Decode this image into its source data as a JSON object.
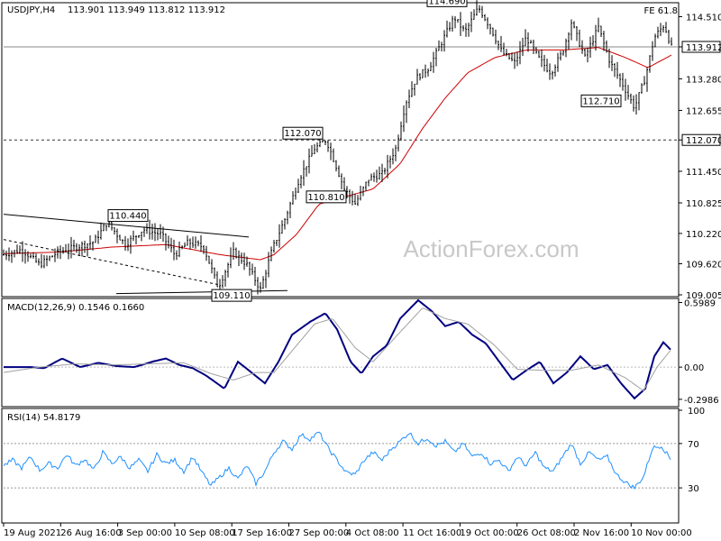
{
  "header": {
    "symbol": "USDJPY,H4",
    "ohlc": "113.901 113.949 113.812 113.912",
    "fe_label": "FE 61.8"
  },
  "watermark": "ActionForex.com",
  "colors": {
    "price": "#000000",
    "ma": "#cc0000",
    "macd": "#000080",
    "macd_signal": "#a0a0a0",
    "rsi": "#1e90ff",
    "background": "#ffffff"
  },
  "chart_data": [
    {
      "type": "candlestick",
      "title": "USDJPY,H4",
      "ylim": [
        109.005,
        114.75
      ],
      "y_ticks": [
        "114.510",
        "113.912",
        "113.280",
        "112.655",
        "112.070",
        "111.450",
        "110.825",
        "110.220",
        "109.620",
        "109.005"
      ],
      "x_ticks": [
        "19 Aug 2021",
        "26 Aug 16:00",
        "3 Sep 00:00",
        "10 Sep 08:00",
        "17 Sep 16:00",
        "27 Sep 00:00",
        "4 Oct 08:00",
        "11 Oct 16:00",
        "19 Oct 00:00",
        "26 Oct 08:00",
        "2 Nov 16:00",
        "10 Nov 00:00"
      ],
      "current_price": 113.912,
      "horizontal_levels": [
        {
          "value": 113.912,
          "style": "solid"
        },
        {
          "value": 112.07,
          "style": "dashed"
        }
      ],
      "labels": [
        {
          "text": "114.690",
          "value": 114.69
        },
        {
          "text": "112.070",
          "value": 112.07
        },
        {
          "text": "110.810",
          "value": 110.81
        },
        {
          "text": "110.440",
          "value": 110.44
        },
        {
          "text": "109.110",
          "value": 109.11
        },
        {
          "text": "112.710",
          "value": 112.71
        }
      ],
      "price_path": [
        {
          "x": 0,
          "v": 109.8
        },
        {
          "x": 20,
          "v": 109.9
        },
        {
          "x": 40,
          "v": 109.6
        },
        {
          "x": 60,
          "v": 109.85
        },
        {
          "x": 80,
          "v": 109.95
        },
        {
          "x": 100,
          "v": 110.05
        },
        {
          "x": 115,
          "v": 110.44
        },
        {
          "x": 135,
          "v": 110.0
        },
        {
          "x": 155,
          "v": 110.3
        },
        {
          "x": 175,
          "v": 110.2
        },
        {
          "x": 190,
          "v": 109.8
        },
        {
          "x": 205,
          "v": 110.05
        },
        {
          "x": 222,
          "v": 109.95
        },
        {
          "x": 238,
          "v": 109.15
        },
        {
          "x": 255,
          "v": 109.85
        },
        {
          "x": 270,
          "v": 109.6
        },
        {
          "x": 285,
          "v": 109.11
        },
        {
          "x": 298,
          "v": 109.9
        },
        {
          "x": 312,
          "v": 110.5
        },
        {
          "x": 328,
          "v": 111.3
        },
        {
          "x": 345,
          "v": 111.9
        },
        {
          "x": 358,
          "v": 112.07
        },
        {
          "x": 368,
          "v": 111.6
        },
        {
          "x": 378,
          "v": 111.1
        },
        {
          "x": 390,
          "v": 110.81
        },
        {
          "x": 405,
          "v": 111.3
        },
        {
          "x": 420,
          "v": 111.4
        },
        {
          "x": 435,
          "v": 111.9
        },
        {
          "x": 446,
          "v": 112.8
        },
        {
          "x": 458,
          "v": 113.3
        },
        {
          "x": 472,
          "v": 113.5
        },
        {
          "x": 486,
          "v": 114.0
        },
        {
          "x": 500,
          "v": 114.5
        },
        {
          "x": 512,
          "v": 114.2
        },
        {
          "x": 527,
          "v": 114.69
        },
        {
          "x": 540,
          "v": 114.3
        },
        {
          "x": 553,
          "v": 113.8
        },
        {
          "x": 567,
          "v": 113.6
        },
        {
          "x": 580,
          "v": 114.1
        },
        {
          "x": 593,
          "v": 113.7
        },
        {
          "x": 607,
          "v": 113.4
        },
        {
          "x": 620,
          "v": 113.8
        },
        {
          "x": 630,
          "v": 114.4
        },
        {
          "x": 645,
          "v": 113.7
        },
        {
          "x": 660,
          "v": 114.3
        },
        {
          "x": 673,
          "v": 113.6
        },
        {
          "x": 686,
          "v": 113.2
        },
        {
          "x": 700,
          "v": 112.71
        },
        {
          "x": 712,
          "v": 113.3
        },
        {
          "x": 722,
          "v": 114.1
        },
        {
          "x": 733,
          "v": 114.35
        },
        {
          "x": 741,
          "v": 113.912
        }
      ],
      "ma_path": [
        {
          "x": 0,
          "v": 109.82
        },
        {
          "x": 60,
          "v": 109.85
        },
        {
          "x": 120,
          "v": 109.95
        },
        {
          "x": 180,
          "v": 110.0
        },
        {
          "x": 240,
          "v": 109.8
        },
        {
          "x": 285,
          "v": 109.7
        },
        {
          "x": 300,
          "v": 109.8
        },
        {
          "x": 325,
          "v": 110.2
        },
        {
          "x": 350,
          "v": 110.8
        },
        {
          "x": 380,
          "v": 110.95
        },
        {
          "x": 410,
          "v": 111.1
        },
        {
          "x": 440,
          "v": 111.6
        },
        {
          "x": 465,
          "v": 112.3
        },
        {
          "x": 490,
          "v": 112.9
        },
        {
          "x": 515,
          "v": 113.4
        },
        {
          "x": 545,
          "v": 113.7
        },
        {
          "x": 580,
          "v": 113.85
        },
        {
          "x": 620,
          "v": 113.85
        },
        {
          "x": 660,
          "v": 113.9
        },
        {
          "x": 690,
          "v": 113.7
        },
        {
          "x": 715,
          "v": 113.5
        },
        {
          "x": 741,
          "v": 113.75
        }
      ],
      "trendlines": [
        {
          "from": {
            "x": 0,
            "v": 110.6
          },
          "to": {
            "x": 272,
            "v": 110.15
          }
        },
        {
          "from": {
            "x": 125,
            "v": 109.03
          },
          "to": {
            "x": 315,
            "v": 109.09
          }
        },
        {
          "from": {
            "x": 0,
            "v": 110.1
          },
          "to": {
            "x": 240,
            "v": 109.2
          },
          "style": "dashed"
        }
      ]
    },
    {
      "type": "line",
      "title": "MACD(12,26,9) 0.1546 0.1660",
      "ylim": [
        -0.35,
        0.62
      ],
      "y_ticks": [
        "0.5989",
        "0.00",
        "-0.2986"
      ],
      "series": [
        {
          "name": "MACD",
          "points": [
            {
              "x": 0,
              "v": 0.0
            },
            {
              "x": 30,
              "v": 0.0
            },
            {
              "x": 45,
              "v": -0.01
            },
            {
              "x": 65,
              "v": 0.08
            },
            {
              "x": 85,
              "v": 0.0
            },
            {
              "x": 105,
              "v": 0.04
            },
            {
              "x": 125,
              "v": 0.01
            },
            {
              "x": 145,
              "v": 0.0
            },
            {
              "x": 165,
              "v": 0.05
            },
            {
              "x": 180,
              "v": 0.08
            },
            {
              "x": 195,
              "v": 0.02
            },
            {
              "x": 210,
              "v": -0.01
            },
            {
              "x": 225,
              "v": -0.08
            },
            {
              "x": 245,
              "v": -0.2
            },
            {
              "x": 260,
              "v": 0.05
            },
            {
              "x": 275,
              "v": -0.05
            },
            {
              "x": 290,
              "v": -0.15
            },
            {
              "x": 305,
              "v": 0.05
            },
            {
              "x": 320,
              "v": 0.3
            },
            {
              "x": 340,
              "v": 0.42
            },
            {
              "x": 357,
              "v": 0.5
            },
            {
              "x": 370,
              "v": 0.35
            },
            {
              "x": 385,
              "v": 0.05
            },
            {
              "x": 397,
              "v": -0.06
            },
            {
              "x": 410,
              "v": 0.1
            },
            {
              "x": 425,
              "v": 0.2
            },
            {
              "x": 440,
              "v": 0.45
            },
            {
              "x": 460,
              "v": 0.62
            },
            {
              "x": 475,
              "v": 0.52
            },
            {
              "x": 490,
              "v": 0.38
            },
            {
              "x": 505,
              "v": 0.42
            },
            {
              "x": 520,
              "v": 0.3
            },
            {
              "x": 535,
              "v": 0.22
            },
            {
              "x": 550,
              "v": 0.05
            },
            {
              "x": 565,
              "v": -0.12
            },
            {
              "x": 580,
              "v": -0.03
            },
            {
              "x": 595,
              "v": 0.05
            },
            {
              "x": 610,
              "v": -0.15
            },
            {
              "x": 625,
              "v": -0.05
            },
            {
              "x": 640,
              "v": 0.1
            },
            {
              "x": 655,
              "v": -0.02
            },
            {
              "x": 670,
              "v": 0.02
            },
            {
              "x": 685,
              "v": -0.15
            },
            {
              "x": 700,
              "v": -0.29
            },
            {
              "x": 712,
              "v": -0.2
            },
            {
              "x": 722,
              "v": 0.1
            },
            {
              "x": 732,
              "v": 0.23
            },
            {
              "x": 741,
              "v": 0.1546
            }
          ]
        },
        {
          "name": "Signal",
          "points": [
            {
              "x": 0,
              "v": -0.05
            },
            {
              "x": 40,
              "v": 0.0
            },
            {
              "x": 80,
              "v": 0.03
            },
            {
              "x": 120,
              "v": 0.02
            },
            {
              "x": 160,
              "v": 0.03
            },
            {
              "x": 200,
              "v": 0.04
            },
            {
              "x": 230,
              "v": -0.06
            },
            {
              "x": 255,
              "v": -0.12
            },
            {
              "x": 280,
              "v": -0.05
            },
            {
              "x": 300,
              "v": -0.05
            },
            {
              "x": 320,
              "v": 0.15
            },
            {
              "x": 345,
              "v": 0.4
            },
            {
              "x": 365,
              "v": 0.45
            },
            {
              "x": 390,
              "v": 0.18
            },
            {
              "x": 410,
              "v": 0.05
            },
            {
              "x": 435,
              "v": 0.28
            },
            {
              "x": 465,
              "v": 0.55
            },
            {
              "x": 490,
              "v": 0.45
            },
            {
              "x": 515,
              "v": 0.4
            },
            {
              "x": 545,
              "v": 0.2
            },
            {
              "x": 570,
              "v": -0.02
            },
            {
              "x": 600,
              "v": -0.03
            },
            {
              "x": 630,
              "v": -0.03
            },
            {
              "x": 660,
              "v": 0.02
            },
            {
              "x": 690,
              "v": -0.1
            },
            {
              "x": 710,
              "v": -0.22
            },
            {
              "x": 725,
              "v": 0.0
            },
            {
              "x": 741,
              "v": 0.166
            }
          ]
        }
      ]
    },
    {
      "type": "line",
      "title": "RSI(14) 54.8179",
      "ylim": [
        0,
        100
      ],
      "y_ticks": [
        "100",
        "70",
        "30"
      ],
      "series": [
        {
          "name": "RSI",
          "points": [
            {
              "x": 0,
              "v": 50
            },
            {
              "x": 10,
              "v": 55
            },
            {
              "x": 20,
              "v": 48
            },
            {
              "x": 30,
              "v": 58
            },
            {
              "x": 40,
              "v": 46
            },
            {
              "x": 50,
              "v": 52
            },
            {
              "x": 60,
              "v": 48
            },
            {
              "x": 70,
              "v": 60
            },
            {
              "x": 80,
              "v": 50
            },
            {
              "x": 90,
              "v": 56
            },
            {
              "x": 100,
              "v": 46
            },
            {
              "x": 110,
              "v": 62
            },
            {
              "x": 120,
              "v": 52
            },
            {
              "x": 130,
              "v": 58
            },
            {
              "x": 140,
              "v": 48
            },
            {
              "x": 150,
              "v": 55
            },
            {
              "x": 160,
              "v": 45
            },
            {
              "x": 170,
              "v": 60
            },
            {
              "x": 180,
              "v": 52
            },
            {
              "x": 190,
              "v": 55
            },
            {
              "x": 200,
              "v": 45
            },
            {
              "x": 210,
              "v": 58
            },
            {
              "x": 220,
              "v": 44
            },
            {
              "x": 230,
              "v": 32
            },
            {
              "x": 240,
              "v": 40
            },
            {
              "x": 250,
              "v": 48
            },
            {
              "x": 260,
              "v": 38
            },
            {
              "x": 270,
              "v": 50
            },
            {
              "x": 280,
              "v": 34
            },
            {
              "x": 290,
              "v": 45
            },
            {
              "x": 300,
              "v": 62
            },
            {
              "x": 310,
              "v": 72
            },
            {
              "x": 320,
              "v": 65
            },
            {
              "x": 330,
              "v": 78
            },
            {
              "x": 340,
              "v": 74
            },
            {
              "x": 350,
              "v": 80
            },
            {
              "x": 360,
              "v": 66
            },
            {
              "x": 370,
              "v": 55
            },
            {
              "x": 380,
              "v": 44
            },
            {
              "x": 390,
              "v": 42
            },
            {
              "x": 400,
              "v": 55
            },
            {
              "x": 410,
              "v": 62
            },
            {
              "x": 420,
              "v": 55
            },
            {
              "x": 430,
              "v": 65
            },
            {
              "x": 440,
              "v": 72
            },
            {
              "x": 450,
              "v": 80
            },
            {
              "x": 460,
              "v": 70
            },
            {
              "x": 470,
              "v": 75
            },
            {
              "x": 480,
              "v": 68
            },
            {
              "x": 490,
              "v": 72
            },
            {
              "x": 500,
              "v": 62
            },
            {
              "x": 510,
              "v": 70
            },
            {
              "x": 520,
              "v": 58
            },
            {
              "x": 530,
              "v": 62
            },
            {
              "x": 540,
              "v": 52
            },
            {
              "x": 550,
              "v": 55
            },
            {
              "x": 560,
              "v": 45
            },
            {
              "x": 570,
              "v": 58
            },
            {
              "x": 580,
              "v": 50
            },
            {
              "x": 590,
              "v": 62
            },
            {
              "x": 600,
              "v": 48
            },
            {
              "x": 610,
              "v": 45
            },
            {
              "x": 620,
              "v": 58
            },
            {
              "x": 630,
              "v": 70
            },
            {
              "x": 640,
              "v": 52
            },
            {
              "x": 650,
              "v": 62
            },
            {
              "x": 660,
              "v": 55
            },
            {
              "x": 670,
              "v": 58
            },
            {
              "x": 680,
              "v": 42
            },
            {
              "x": 690,
              "v": 35
            },
            {
              "x": 700,
              "v": 30
            },
            {
              "x": 710,
              "v": 40
            },
            {
              "x": 720,
              "v": 66
            },
            {
              "x": 730,
              "v": 68
            },
            {
              "x": 741,
              "v": 54.8
            }
          ]
        }
      ]
    }
  ]
}
